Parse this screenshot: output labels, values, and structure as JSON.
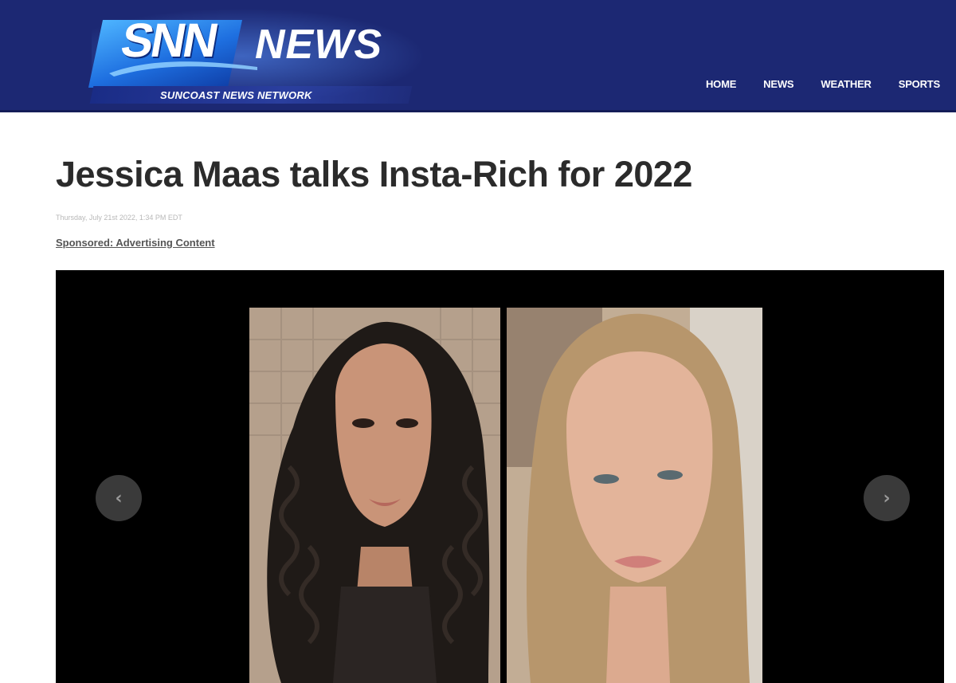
{
  "site": {
    "logo_snn": "SNN",
    "logo_news": "NEWS",
    "tagline": "SUNCOAST NEWS NETWORK",
    "brand_color": "#1c2873"
  },
  "nav": {
    "items": [
      {
        "label": "HOME"
      },
      {
        "label": "NEWS"
      },
      {
        "label": "WEATHER"
      },
      {
        "label": "SPORTS"
      }
    ]
  },
  "article": {
    "headline": "Jessica Maas talks Insta-Rich for 2022",
    "dateline": "Thursday, July 21st 2022, 1:34 PM EDT",
    "sponsored": "Sponsored: Advertising Content"
  },
  "gallery": {
    "prev_icon": "‹",
    "next_icon": "›"
  }
}
